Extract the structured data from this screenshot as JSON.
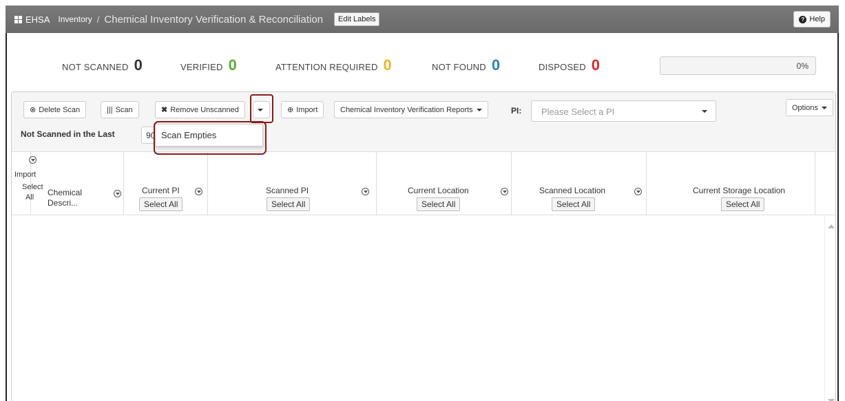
{
  "header": {
    "brand": "EHSA",
    "breadcrumb_inventory": "Inventory",
    "breadcrumb_sep": "/",
    "title": "Chemical Inventory Verification & Reconciliation",
    "edit_labels": "Edit Labels",
    "help": "Help"
  },
  "stats": {
    "not_scanned_label": "NOT SCANNED",
    "not_scanned_value": "0",
    "verified_label": "VERIFIED",
    "verified_value": "0",
    "attention_label": "ATTENTION REQUIRED",
    "attention_value": "0",
    "not_found_label": "NOT FOUND",
    "not_found_value": "0",
    "disposed_label": "DISPOSED",
    "disposed_value": "0",
    "progress_text": "0%",
    "progress_fraction": 0,
    "colors": {
      "not_scanned": "#333333",
      "verified": "#5cab3a",
      "attention": "#f0b429",
      "not_found": "#2a7fc9",
      "disposed": "#d62a2a"
    }
  },
  "toolbar": {
    "delete_scan": "Delete Scan",
    "scan": "Scan",
    "remove_unscanned": "Remove Unscanned",
    "import": "Import",
    "reports": "Chemical Inventory Verification Reports",
    "pi_label": "PI:",
    "pi_placeholder": "Please Select a PI",
    "options": "Options",
    "not_scanned_in_last": "Not Scanned in the Last",
    "days_value": "90",
    "dropdown_item": "Scan Empties"
  },
  "grid": {
    "first_col_import": "Import",
    "first_col_select": "Select",
    "first_col_all": "All",
    "chemical_line1": "Chemical",
    "chemical_line2": "Descri...",
    "select_all": "Select All",
    "columns": [
      "Current PI",
      "Scanned PI",
      "Current Location",
      "Scanned Location",
      "Current Storage Location"
    ]
  }
}
